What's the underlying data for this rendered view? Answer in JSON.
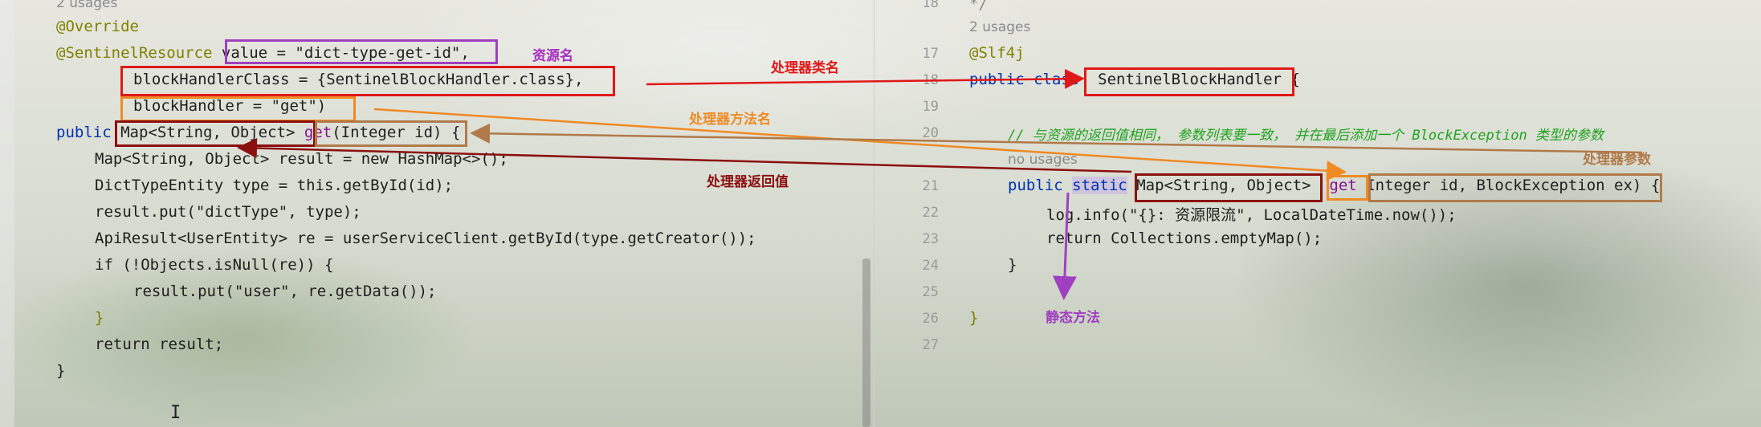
{
  "left_editor": {
    "usages": "2 usages",
    "code": {
      "override": "@Override",
      "sentinel_annot": "@SentinelResource",
      "value_attr": "value = \"dict-type-get-id\",",
      "block_class_attr": "blockHandlerClass = {SentinelBlockHandler.class},",
      "block_handler_attr": "blockHandler = \"get\")",
      "public_kw": "public",
      "return_type": "Map<String, Object>",
      "method_name": "get",
      "params": "(Integer id)",
      "open_brace": "{",
      "line_map": "Map<String, Object> result = new HashMap<>();",
      "line_dict": "DictTypeEntity type = this.getById(id);",
      "line_put_dict": "result.put(\"dictType\", type);",
      "line_apiresult": "ApiResult<UserEntity> re = userServiceClient.getById(type.getCreator());",
      "line_if": "if (!Objects.isNull(re)) {",
      "line_put_user": "result.put(\"user\", re.getData());",
      "line_close_if": "}",
      "line_return": "return result;",
      "line_close": "}"
    }
  },
  "right_editor": {
    "line_numbers": [
      "18",
      "17",
      "18",
      "19",
      "20",
      "21",
      "22",
      "23",
      "24",
      "25",
      "26",
      "27"
    ],
    "usages": "2 usages",
    "no_usages": "no usages",
    "code": {
      "top_comment": "*/",
      "slf4j": "@Slf4j",
      "class_decl_kw": "public class",
      "class_name": "SentinelBlockHandler",
      "class_open": "{",
      "comment_zh": "// 与资源的返回值相同， 参数列表要一致， 并在最后添加一个 BlockException 类型的参数",
      "method_public": "public",
      "method_static": "static",
      "method_return": "Map<String, Object>",
      "method_name": "get",
      "method_params": "Integer id, BlockException ex)",
      "method_open": "{",
      "log_line": "log.info(\"{}: 资源限流\", LocalDateTime.now());",
      "return_line": "return Collections.emptyMap();",
      "close_method": "}",
      "close_class": "}"
    }
  },
  "annotations": {
    "resource_name": "资源名",
    "handler_class_name": "处理器类名",
    "handler_method_name": "处理器方法名",
    "handler_return_value": "处理器返回值",
    "handler_params": "处理器参数",
    "static_method": "静态方法"
  },
  "colors": {
    "purple": "#a040c0",
    "red": "#e01818",
    "orange": "#f08a24",
    "dark_red": "#8b1010",
    "brown": "#b07a4a",
    "violet_label": "#a52fbf"
  }
}
